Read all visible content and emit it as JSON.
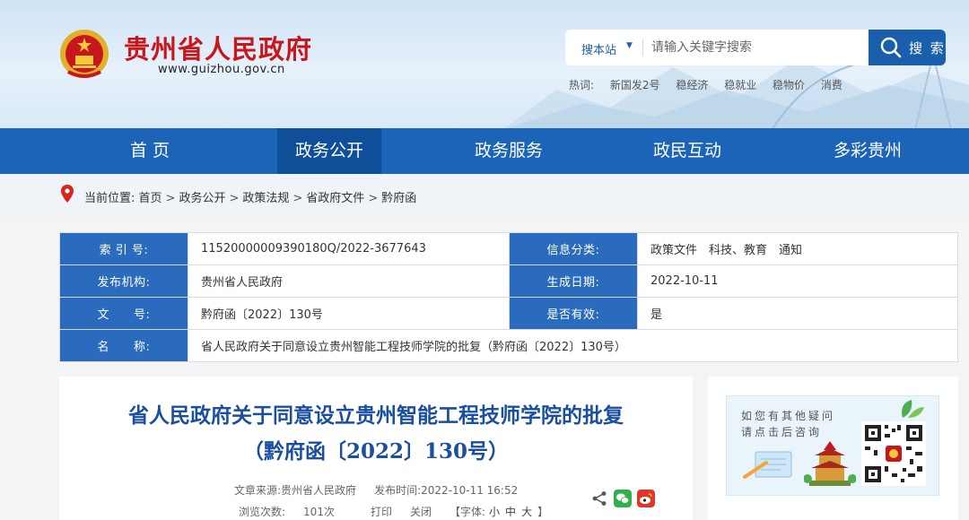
{
  "header": {
    "site_title": "贵州省人民政府",
    "site_url": "www.guizhou.gov.cn",
    "search": {
      "scope": "搜本站",
      "placeholder": "请输入关键字搜索",
      "button_label": "搜 索"
    },
    "hot": {
      "label": "热词:",
      "items": [
        "新国发2号",
        "稳经济",
        "稳就业",
        "稳物价",
        "消费"
      ]
    }
  },
  "nav": {
    "items": [
      "首 页",
      "政务公开",
      "政务服务",
      "政民互动",
      "多彩贵州"
    ],
    "active_index": 1
  },
  "breadcrumb": {
    "prefix": "当前位置:",
    "items": [
      "首页",
      "政务公开",
      "政策法规",
      "省政府文件",
      "黔府函"
    ],
    "separator": ">"
  },
  "info": {
    "index_label": "索 引 号:",
    "index_value": "11520000009390180Q/2022-3677643",
    "category_label": "信息分类:",
    "category_value": "政策文件　科技、教育　通知",
    "issuer_label": "发布机构:",
    "issuer_value": "贵州省人民政府",
    "date_label": "生成日期:",
    "date_value": "2022-10-11",
    "docno_label": "文　　号:",
    "docno_value": "黔府函〔2022〕130号",
    "valid_label": "是否有效:",
    "valid_value": "是",
    "name_label": "名　　称:",
    "name_value": "省人民政府关于同意设立贵州智能工程技师学院的批复（黔府函〔2022〕130号）"
  },
  "article": {
    "title_line1": "省人民政府关于同意设立贵州智能工程技师学院的批复",
    "title_line2": "（黔府函〔2022〕130号）",
    "source_label": "文章来源:",
    "source_value": "贵州省人民政府",
    "time_label": "发布时间:",
    "time_value": "2022-10-11 16:52",
    "views_label": "浏览次数:",
    "views_value": "101次",
    "print_label": "打印",
    "close_label": "关闭",
    "font_label": "【字体:",
    "font_small": "小",
    "font_medium": "中",
    "font_large": "大",
    "font_end": "】"
  },
  "sidebar": {
    "ask_line1": "如您有其他疑问",
    "ask_line2": "请点击后咨询"
  },
  "colors": {
    "brand_red": "#c8161d",
    "nav_blue": "#1b64b8",
    "nav_active": "#0f4f99",
    "table_key_blue": "#2a6bbd",
    "title_blue": "#1a4fa0",
    "wechat_green": "#2fb04a",
    "weibo_red": "#e0362c"
  }
}
